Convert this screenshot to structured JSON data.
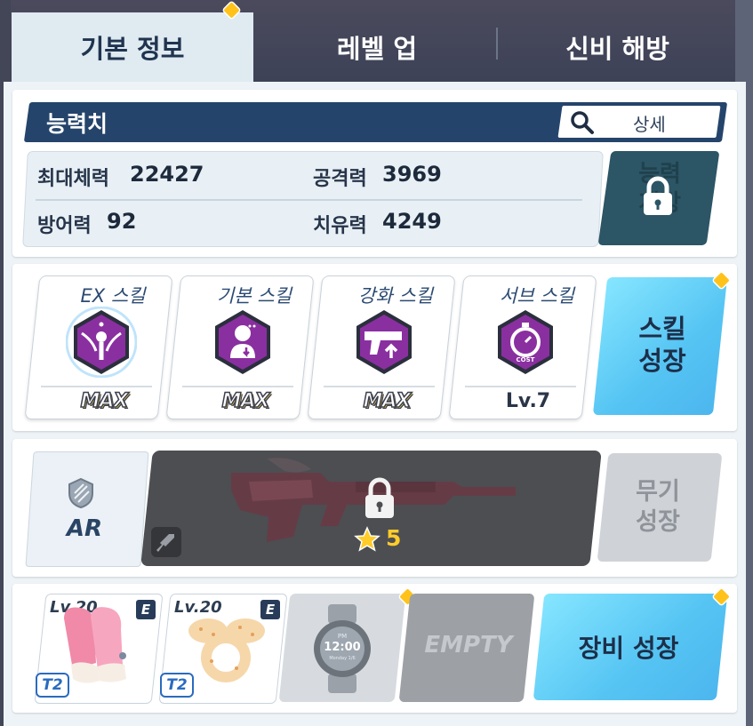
{
  "tabs": {
    "basic_info": "기본 정보",
    "level_up": "레벨 업",
    "mystic": "신비 해방"
  },
  "stats": {
    "title": "능력치",
    "detail_label": "상세",
    "max_hp_label": "최대체력",
    "max_hp": "22427",
    "attack_label": "공격력",
    "attack": "3969",
    "defense_label": "방어력",
    "defense": "92",
    "healing_label": "치유력",
    "healing": "4249",
    "growth_label_line1": "능력",
    "growth_label_line2": "개방"
  },
  "skills": {
    "items": [
      {
        "name": "EX 스킬",
        "level": "MAX",
        "icon": "ex-skill-icon"
      },
      {
        "name": "기본 스킬",
        "level": "MAX",
        "icon": "basic-skill-icon"
      },
      {
        "name": "강화 스킬",
        "level": "MAX",
        "icon": "enhanced-skill-icon"
      },
      {
        "name": "서브 스킬",
        "level": "Lv.7",
        "icon": "sub-skill-icon"
      }
    ],
    "growth_line1": "스킬",
    "growth_line2": "성장"
  },
  "weapon": {
    "type": "AR",
    "stars": "5",
    "growth_line1": "무기",
    "growth_line2": "성장"
  },
  "equipment": {
    "items": [
      {
        "level": "Lv.20",
        "grade": "E",
        "tier": "T2",
        "icon": "gloves-icon"
      },
      {
        "level": "Lv.20",
        "grade": "E",
        "tier": "T2",
        "icon": "hairpin-icon"
      }
    ],
    "watch_time": "12:00",
    "watch_top": "PM",
    "watch_sub": "Monday 1/6",
    "empty_label": "EMPTY",
    "growth_label": "장비 성장"
  },
  "colors": {
    "accent_blue": "#55c4f3",
    "header_navy": "#25446b",
    "notif_gold": "#ffc21a",
    "skill_purple": "#8a2fa0"
  }
}
